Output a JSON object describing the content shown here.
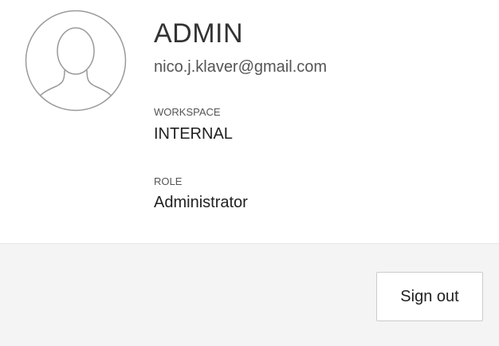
{
  "profile": {
    "avatar_icon": "user-placeholder-icon",
    "username": "ADMIN",
    "email": "nico.j.klaver@gmail.com",
    "workspace": {
      "label": "WORKSPACE",
      "value": "INTERNAL"
    },
    "role": {
      "label": "ROLE",
      "value": "Administrator"
    }
  },
  "footer": {
    "sign_out_label": "Sign out"
  },
  "colors": {
    "footer_bg": "#f4f4f4",
    "avatar_stroke": "#9a9a9a",
    "text": "#222222"
  }
}
